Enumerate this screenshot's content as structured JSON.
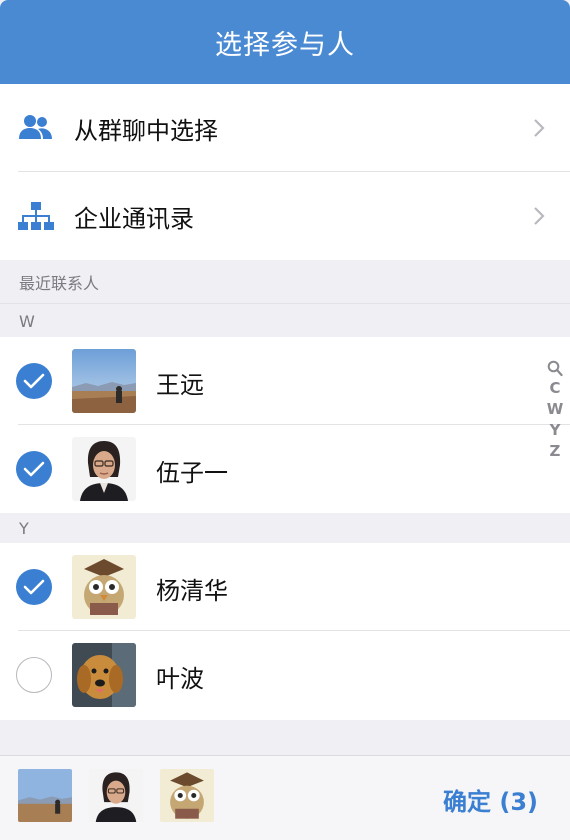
{
  "header": {
    "title": "选择参与人"
  },
  "entries": [
    {
      "label": "从群聊中选择",
      "icon": "group-icon"
    },
    {
      "label": "企业通讯录",
      "icon": "org-chart-icon"
    }
  ],
  "recent_section": {
    "label": "最近联系人"
  },
  "groups": [
    {
      "letter": "W",
      "contacts": [
        {
          "name": "王远",
          "selected": true,
          "avatar": "landscape-photo"
        },
        {
          "name": "伍子一",
          "selected": true,
          "avatar": "woman-portrait-photo"
        }
      ]
    },
    {
      "letter": "Y",
      "contacts": [
        {
          "name": "杨清华",
          "selected": true,
          "avatar": "cartoon-owl-photo"
        },
        {
          "name": "叶波",
          "selected": false,
          "avatar": "golden-retriever-photo"
        }
      ]
    }
  ],
  "index_bar": [
    "search-icon",
    "C",
    "W",
    "Y",
    "Z"
  ],
  "footer": {
    "confirm_label": "确定 (3)"
  },
  "colors": {
    "accent": "#4a8ad3",
    "check": "#3a7fd1"
  }
}
